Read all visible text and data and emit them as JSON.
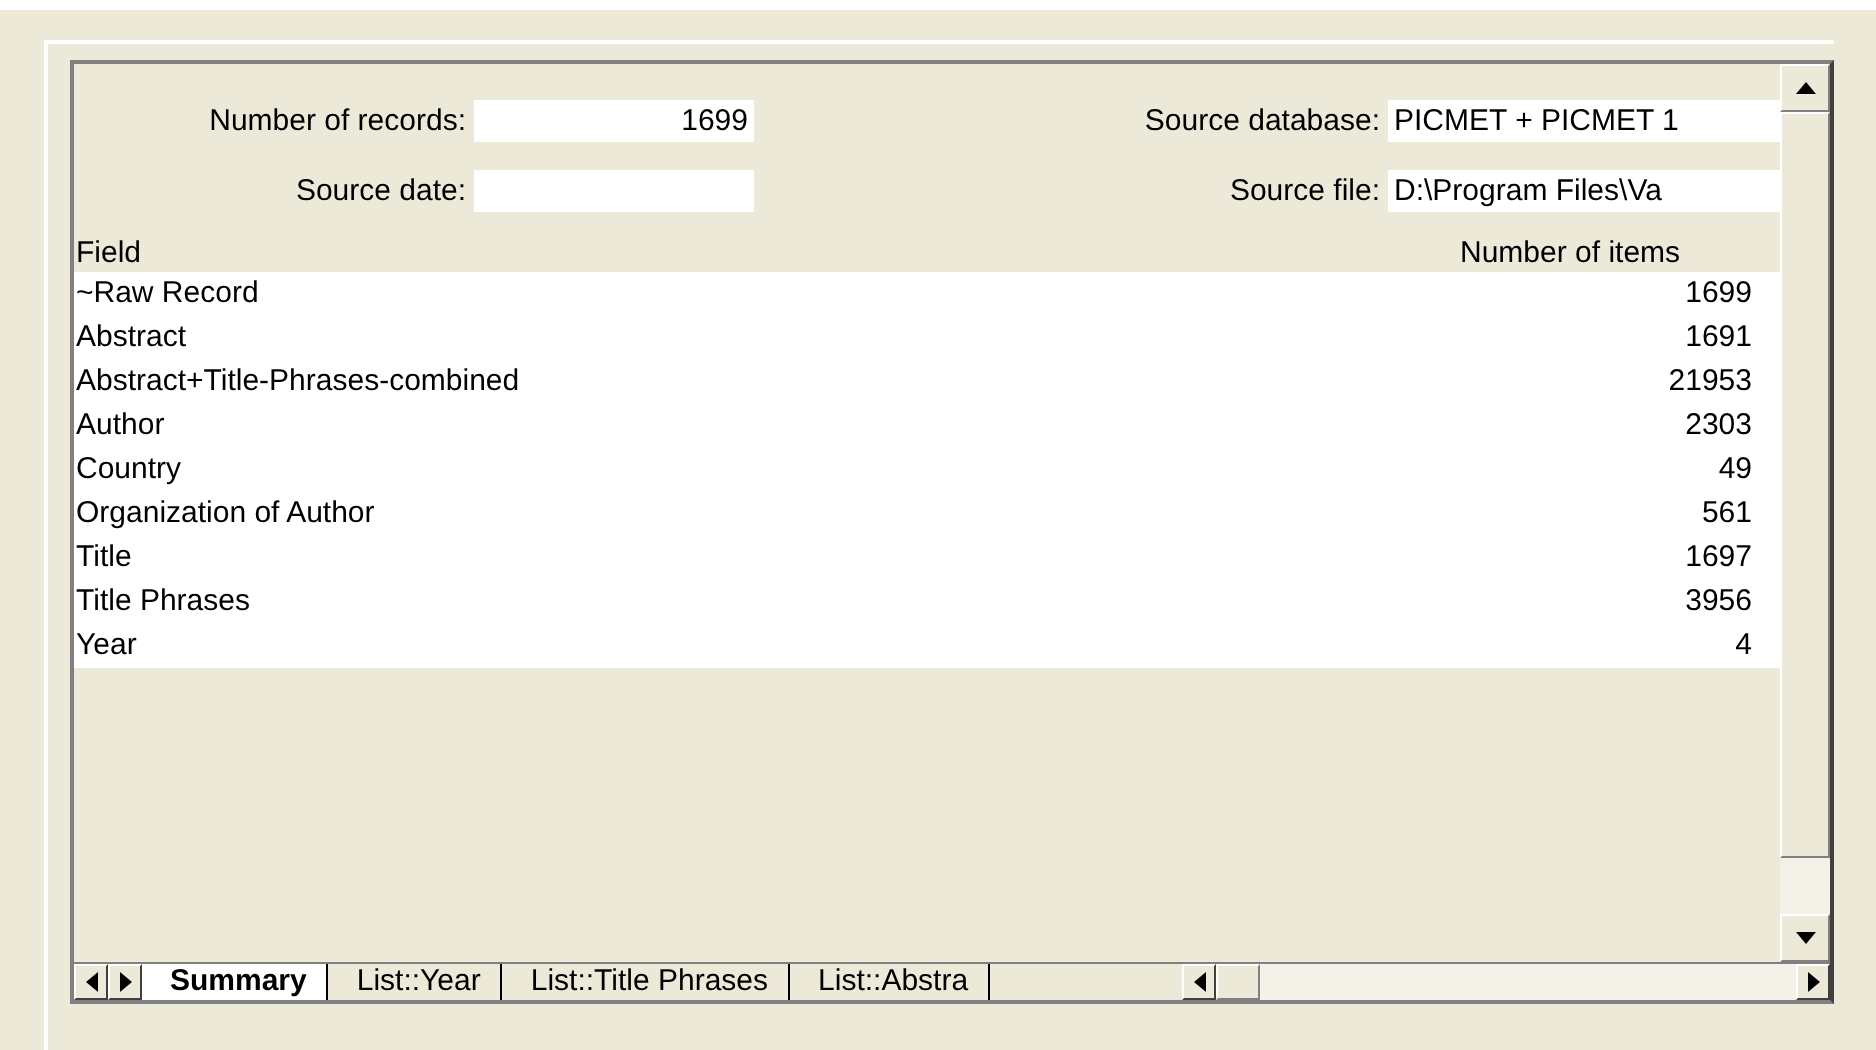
{
  "info_fields": [
    {
      "label": "Number of records:",
      "value": "1699",
      "kind": "number"
    },
    {
      "label": "Source database:",
      "value": "PICMET + PICMET 1",
      "kind": "text"
    },
    {
      "label": "Source date:",
      "kind": "number"
    },
    {
      "label": "Source file:",
      "value": "D:\\Program Files\\Va",
      "kind": "text"
    }
  ],
  "table": {
    "columns": [
      "Field",
      "Number of items"
    ],
    "rows": [
      [
        "~Raw Record",
        "1699"
      ],
      [
        "Abstract",
        "1691"
      ],
      [
        "Abstract+Title-Phrases-combined",
        "21953"
      ],
      [
        "Author",
        "2303"
      ],
      [
        "Country",
        "49"
      ],
      [
        "Organization of Author",
        "561"
      ],
      [
        "Title",
        "1697"
      ],
      [
        "Title Phrases",
        "3956"
      ],
      [
        "Year",
        "4"
      ]
    ]
  },
  "sheet_tabs": [
    {
      "label": "Summary",
      "selected": true
    },
    {
      "label": "List::Year",
      "selected": false
    },
    {
      "label": "List::Title Phrases",
      "selected": false
    },
    {
      "label": "List::Abstra",
      "selected": false
    }
  ]
}
